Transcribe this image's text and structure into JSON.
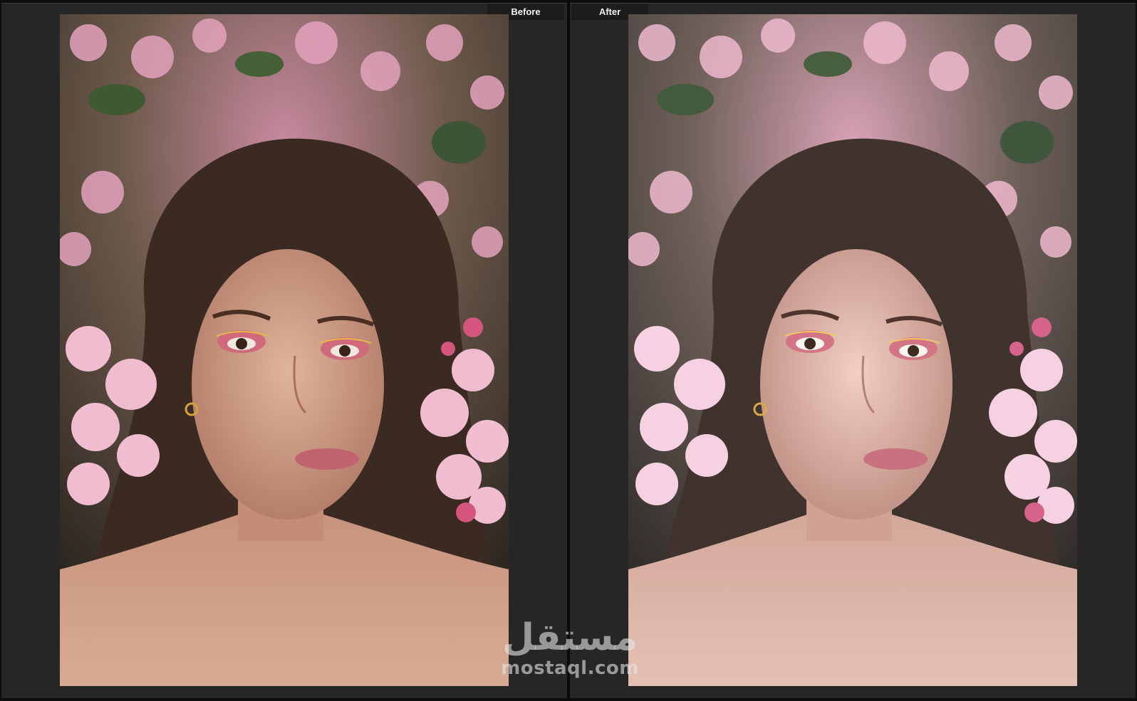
{
  "compare": {
    "before_label": "Before",
    "after_label": "After"
  },
  "watermark": {
    "arabic": "مستقل",
    "latin": "mostaql.com"
  },
  "colors": {
    "panel_bg": "#262626",
    "frame_bg": "#0e0e0e",
    "label_text": "#f2f2f2"
  }
}
